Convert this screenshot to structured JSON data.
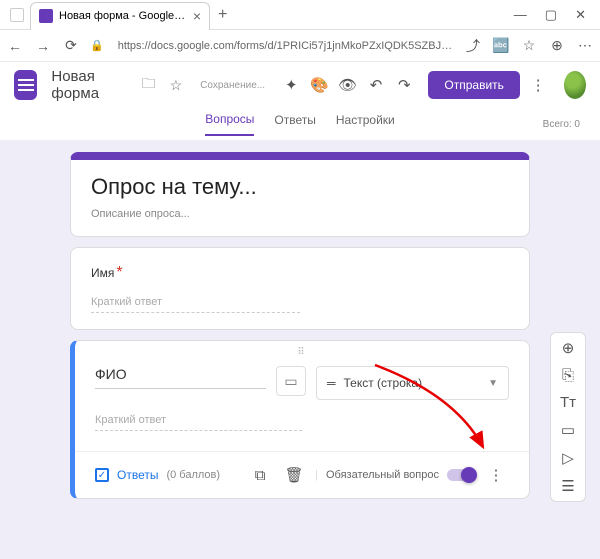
{
  "browser": {
    "tab_title": "Новая форма - Google Формы",
    "url": "https://docs.google.com/forms/d/1PRICi57j1jnMkoPZxIQDK5SZBJEQRBTO..."
  },
  "header": {
    "title": "Новая форма",
    "save_status": "Сохранение...",
    "send_button": "Отправить"
  },
  "tabs": {
    "questions": "Вопросы",
    "responses": "Ответы",
    "settings": "Настройки",
    "total": "Всего: 0"
  },
  "form": {
    "title": "Опрос на тему...",
    "description": "Описание опроса..."
  },
  "question1": {
    "label": "Имя",
    "placeholder": "Краткий ответ"
  },
  "question2": {
    "label": "ФИО",
    "type_label": "Текст (строка)",
    "short_answer_placeholder": "Краткий ответ",
    "answers_label": "Ответы",
    "points": "(0 баллов)",
    "required_label": "Обязательный вопрос"
  }
}
